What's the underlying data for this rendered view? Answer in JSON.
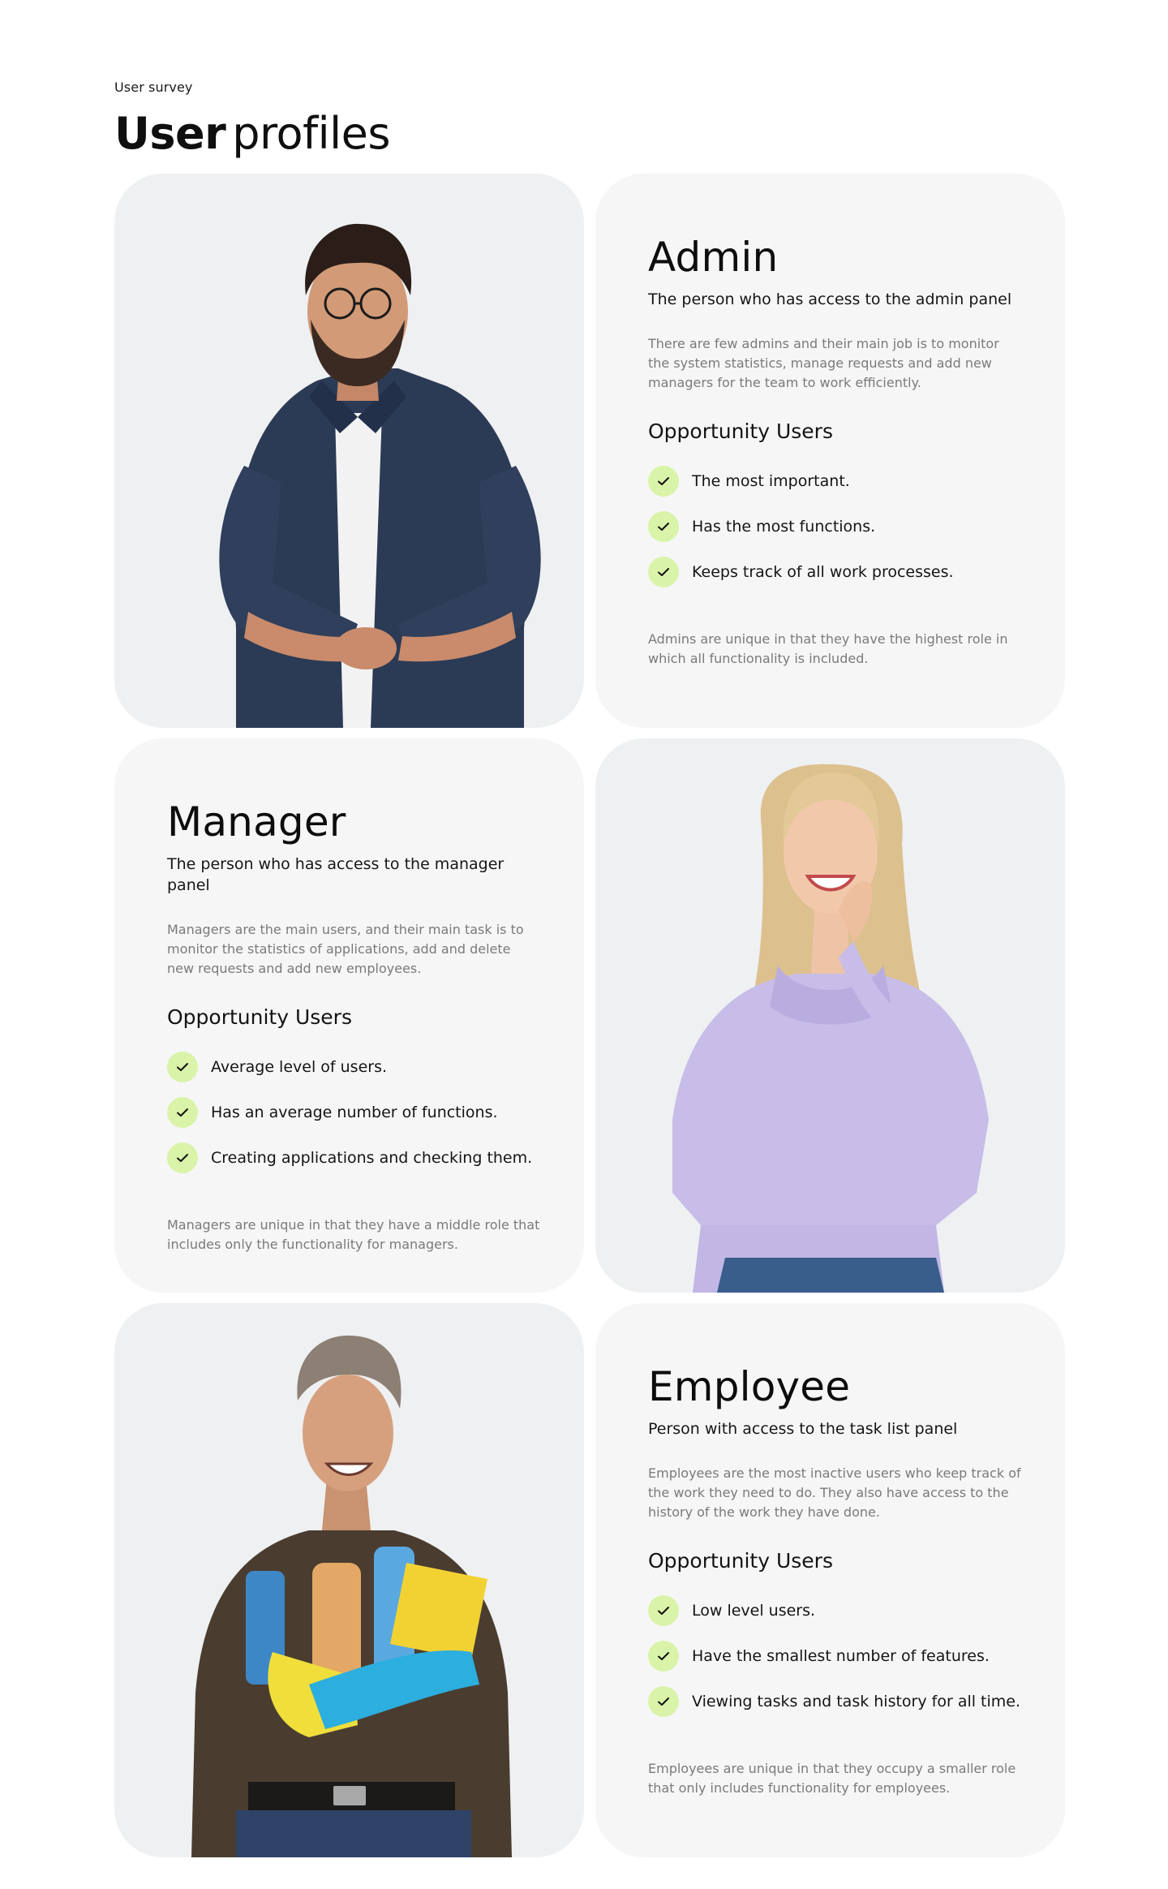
{
  "header": {
    "kicker": "User survey",
    "title_strong": "User",
    "title_light": "profiles"
  },
  "colors": {
    "check_bg": "#d9f3a8",
    "card_info_bg": "#f6f6f6",
    "card_photo_bg": "#eef0f2"
  },
  "profiles": {
    "admin": {
      "title": "Admin",
      "subtitle": "The person who has access to the admin panel",
      "description": "There are few admins and their main job is to monitor the system statistics, manage requests and add new managers for the team to work efficiently.",
      "opportunity_title": "Opportunity Users",
      "items": [
        "The most important.",
        "Has the most functions.",
        "Keeps track of all work processes."
      ],
      "note": "Admins are unique in that they have the highest role in which all functionality is included."
    },
    "manager": {
      "title": "Manager",
      "subtitle": "The person who has access to the manager panel",
      "description": "Managers are the main users, and their main task is to monitor the statistics of applications, add and delete new requests and add new employees.",
      "opportunity_title": "Opportunity Users",
      "items": [
        "Average level of users.",
        "Has an average number of functions.",
        "Creating applications and checking them."
      ],
      "note": "Managers are unique in that they have a middle role that includes only the functionality for managers."
    },
    "employee": {
      "title": "Employee",
      "subtitle": "Person with access to the task list panel",
      "description": "Employees are the most inactive users who keep track of the work they need to do. They also have access to the history of the work they have done.",
      "opportunity_title": "Opportunity Users",
      "items": [
        "Low level users.",
        "Have the smallest number of features.",
        "Viewing tasks and task history for all time."
      ],
      "note": "Employees are unique in that they occupy a smaller role that only includes functionality for employees."
    }
  }
}
